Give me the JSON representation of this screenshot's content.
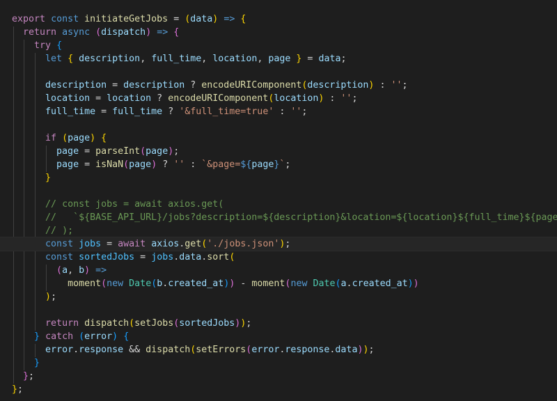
{
  "editor": {
    "language": "javascript",
    "lines": [
      [
        [
          "export",
          "ctl"
        ],
        [
          " ",
          "plain"
        ],
        [
          "const",
          "kw"
        ],
        [
          " ",
          "plain"
        ],
        [
          "initiateGetJobs",
          "fn"
        ],
        [
          " = ",
          "op"
        ],
        [
          "(",
          "br1"
        ],
        [
          "data",
          "var"
        ],
        [
          ")",
          "br1"
        ],
        [
          " ",
          "plain"
        ],
        [
          "=>",
          "arrow"
        ],
        [
          " ",
          "plain"
        ],
        [
          "{",
          "br1"
        ]
      ],
      [
        [
          "  ",
          "plain"
        ],
        [
          "return",
          "ctl"
        ],
        [
          " ",
          "plain"
        ],
        [
          "async",
          "kw"
        ],
        [
          " ",
          "plain"
        ],
        [
          "(",
          "br2"
        ],
        [
          "dispatch",
          "var"
        ],
        [
          ")",
          "br2"
        ],
        [
          " ",
          "plain"
        ],
        [
          "=>",
          "arrow"
        ],
        [
          " ",
          "plain"
        ],
        [
          "{",
          "br2"
        ]
      ],
      [
        [
          "    ",
          "plain"
        ],
        [
          "try",
          "ctl"
        ],
        [
          " ",
          "plain"
        ],
        [
          "{",
          "br3"
        ]
      ],
      [
        [
          "      ",
          "plain"
        ],
        [
          "let",
          "kw"
        ],
        [
          " ",
          "plain"
        ],
        [
          "{",
          "br1"
        ],
        [
          " ",
          "plain"
        ],
        [
          "description",
          "var"
        ],
        [
          ", ",
          "plain"
        ],
        [
          "full_time",
          "var"
        ],
        [
          ", ",
          "plain"
        ],
        [
          "location",
          "var"
        ],
        [
          ", ",
          "plain"
        ],
        [
          "page",
          "var"
        ],
        [
          " ",
          "plain"
        ],
        [
          "}",
          "br1"
        ],
        [
          " = ",
          "op"
        ],
        [
          "data",
          "var"
        ],
        [
          ";",
          "plain"
        ]
      ],
      [],
      [
        [
          "      ",
          "plain"
        ],
        [
          "description",
          "var"
        ],
        [
          " = ",
          "op"
        ],
        [
          "description",
          "var"
        ],
        [
          " ? ",
          "op"
        ],
        [
          "encodeURIComponent",
          "fn"
        ],
        [
          "(",
          "br1"
        ],
        [
          "description",
          "var"
        ],
        [
          ")",
          "br1"
        ],
        [
          " : ",
          "op"
        ],
        [
          "''",
          "str"
        ],
        [
          ";",
          "plain"
        ]
      ],
      [
        [
          "      ",
          "plain"
        ],
        [
          "location",
          "var"
        ],
        [
          " = ",
          "op"
        ],
        [
          "location",
          "var"
        ],
        [
          " ? ",
          "op"
        ],
        [
          "encodeURIComponent",
          "fn"
        ],
        [
          "(",
          "br1"
        ],
        [
          "location",
          "var"
        ],
        [
          ")",
          "br1"
        ],
        [
          " : ",
          "op"
        ],
        [
          "''",
          "str"
        ],
        [
          ";",
          "plain"
        ]
      ],
      [
        [
          "      ",
          "plain"
        ],
        [
          "full_time",
          "var"
        ],
        [
          " = ",
          "op"
        ],
        [
          "full_time",
          "var"
        ],
        [
          " ? ",
          "op"
        ],
        [
          "'&full_time=true'",
          "str"
        ],
        [
          " : ",
          "op"
        ],
        [
          "''",
          "str"
        ],
        [
          ";",
          "plain"
        ]
      ],
      [],
      [
        [
          "      ",
          "plain"
        ],
        [
          "if",
          "ctl"
        ],
        [
          " ",
          "plain"
        ],
        [
          "(",
          "br1"
        ],
        [
          "page",
          "var"
        ],
        [
          ")",
          "br1"
        ],
        [
          " ",
          "plain"
        ],
        [
          "{",
          "br1"
        ]
      ],
      [
        [
          "        ",
          "plain"
        ],
        [
          "page",
          "var"
        ],
        [
          " = ",
          "op"
        ],
        [
          "parseInt",
          "fn"
        ],
        [
          "(",
          "br2"
        ],
        [
          "page",
          "var"
        ],
        [
          ")",
          "br2"
        ],
        [
          ";",
          "plain"
        ]
      ],
      [
        [
          "        ",
          "plain"
        ],
        [
          "page",
          "var"
        ],
        [
          " = ",
          "op"
        ],
        [
          "isNaN",
          "fn"
        ],
        [
          "(",
          "br2"
        ],
        [
          "page",
          "var"
        ],
        [
          ")",
          "br2"
        ],
        [
          " ? ",
          "op"
        ],
        [
          "''",
          "str"
        ],
        [
          " : ",
          "op"
        ],
        [
          "`&page=",
          "str"
        ],
        [
          "${",
          "kw"
        ],
        [
          "page",
          "var"
        ],
        [
          "}",
          "kw"
        ],
        [
          "`",
          "str"
        ],
        [
          ";",
          "plain"
        ]
      ],
      [
        [
          "      ",
          "plain"
        ],
        [
          "}",
          "br1"
        ]
      ],
      [],
      [
        [
          "      ",
          "plain"
        ],
        [
          "// const jobs = await axios.get(",
          "cmt"
        ]
      ],
      [
        [
          "      ",
          "plain"
        ],
        [
          "//   `${BASE_API_URL}/jobs?description=${description}&location=${location}${full_time}${page}`",
          "cmt"
        ]
      ],
      [
        [
          "      ",
          "plain"
        ],
        [
          "// );",
          "cmt"
        ]
      ],
      [
        [
          "      ",
          "plain"
        ],
        [
          "const",
          "kw"
        ],
        [
          " ",
          "plain"
        ],
        [
          "jobs",
          "cst"
        ],
        [
          " = ",
          "op"
        ],
        [
          "await",
          "ctl"
        ],
        [
          " ",
          "plain"
        ],
        [
          "axios",
          "var"
        ],
        [
          ".",
          "plain"
        ],
        [
          "get",
          "fn"
        ],
        [
          "(",
          "br1"
        ],
        [
          "'./jobs.json'",
          "str"
        ],
        [
          ")",
          "br1"
        ],
        [
          ";",
          "plain"
        ]
      ],
      [
        [
          "      ",
          "plain"
        ],
        [
          "const",
          "kw"
        ],
        [
          " ",
          "plain"
        ],
        [
          "sortedJobs",
          "cst"
        ],
        [
          " = ",
          "op"
        ],
        [
          "jobs",
          "cst"
        ],
        [
          ".",
          "plain"
        ],
        [
          "data",
          "var"
        ],
        [
          ".",
          "plain"
        ],
        [
          "sort",
          "fn"
        ],
        [
          "(",
          "br1"
        ]
      ],
      [
        [
          "        ",
          "plain"
        ],
        [
          "(",
          "br2"
        ],
        [
          "a",
          "var"
        ],
        [
          ", ",
          "plain"
        ],
        [
          "b",
          "var"
        ],
        [
          ")",
          "br2"
        ],
        [
          " ",
          "plain"
        ],
        [
          "=>",
          "arrow"
        ]
      ],
      [
        [
          "          ",
          "plain"
        ],
        [
          "moment",
          "fn"
        ],
        [
          "(",
          "br2"
        ],
        [
          "new",
          "kw"
        ],
        [
          " ",
          "plain"
        ],
        [
          "Date",
          "cls"
        ],
        [
          "(",
          "br3"
        ],
        [
          "b",
          "var"
        ],
        [
          ".",
          "plain"
        ],
        [
          "created_at",
          "var"
        ],
        [
          ")",
          "br3"
        ],
        [
          ")",
          "br2"
        ],
        [
          " - ",
          "op"
        ],
        [
          "moment",
          "fn"
        ],
        [
          "(",
          "br2"
        ],
        [
          "new",
          "kw"
        ],
        [
          " ",
          "plain"
        ],
        [
          "Date",
          "cls"
        ],
        [
          "(",
          "br3"
        ],
        [
          "a",
          "var"
        ],
        [
          ".",
          "plain"
        ],
        [
          "created_at",
          "var"
        ],
        [
          ")",
          "br3"
        ],
        [
          ")",
          "br2"
        ]
      ],
      [
        [
          "      ",
          "plain"
        ],
        [
          ")",
          "br1"
        ],
        [
          ";",
          "plain"
        ]
      ],
      [],
      [
        [
          "      ",
          "plain"
        ],
        [
          "return",
          "ctl"
        ],
        [
          " ",
          "plain"
        ],
        [
          "dispatch",
          "fn"
        ],
        [
          "(",
          "br1"
        ],
        [
          "setJobs",
          "fn"
        ],
        [
          "(",
          "br2"
        ],
        [
          "sortedJobs",
          "var"
        ],
        [
          ")",
          "br2"
        ],
        [
          ")",
          "br1"
        ],
        [
          ";",
          "plain"
        ]
      ],
      [
        [
          "    ",
          "plain"
        ],
        [
          "}",
          "br3"
        ],
        [
          " ",
          "plain"
        ],
        [
          "catch",
          "ctl"
        ],
        [
          " ",
          "plain"
        ],
        [
          "(",
          "br3"
        ],
        [
          "error",
          "var"
        ],
        [
          ")",
          "br3"
        ],
        [
          " ",
          "plain"
        ],
        [
          "{",
          "br3"
        ]
      ],
      [
        [
          "      ",
          "plain"
        ],
        [
          "error",
          "var"
        ],
        [
          ".",
          "plain"
        ],
        [
          "response",
          "var"
        ],
        [
          " && ",
          "op"
        ],
        [
          "dispatch",
          "fn"
        ],
        [
          "(",
          "br1"
        ],
        [
          "setErrors",
          "fn"
        ],
        [
          "(",
          "br2"
        ],
        [
          "error",
          "var"
        ],
        [
          ".",
          "plain"
        ],
        [
          "response",
          "var"
        ],
        [
          ".",
          "plain"
        ],
        [
          "data",
          "var"
        ],
        [
          ")",
          "br2"
        ],
        [
          ")",
          "br1"
        ],
        [
          ";",
          "plain"
        ]
      ],
      [
        [
          "    ",
          "plain"
        ],
        [
          "}",
          "br3"
        ]
      ],
      [
        [
          "  ",
          "plain"
        ],
        [
          "}",
          "br2"
        ],
        [
          ";",
          "plain"
        ]
      ],
      [
        [
          "}",
          "br1"
        ],
        [
          ";",
          "plain"
        ]
      ]
    ],
    "active_line": 17
  }
}
